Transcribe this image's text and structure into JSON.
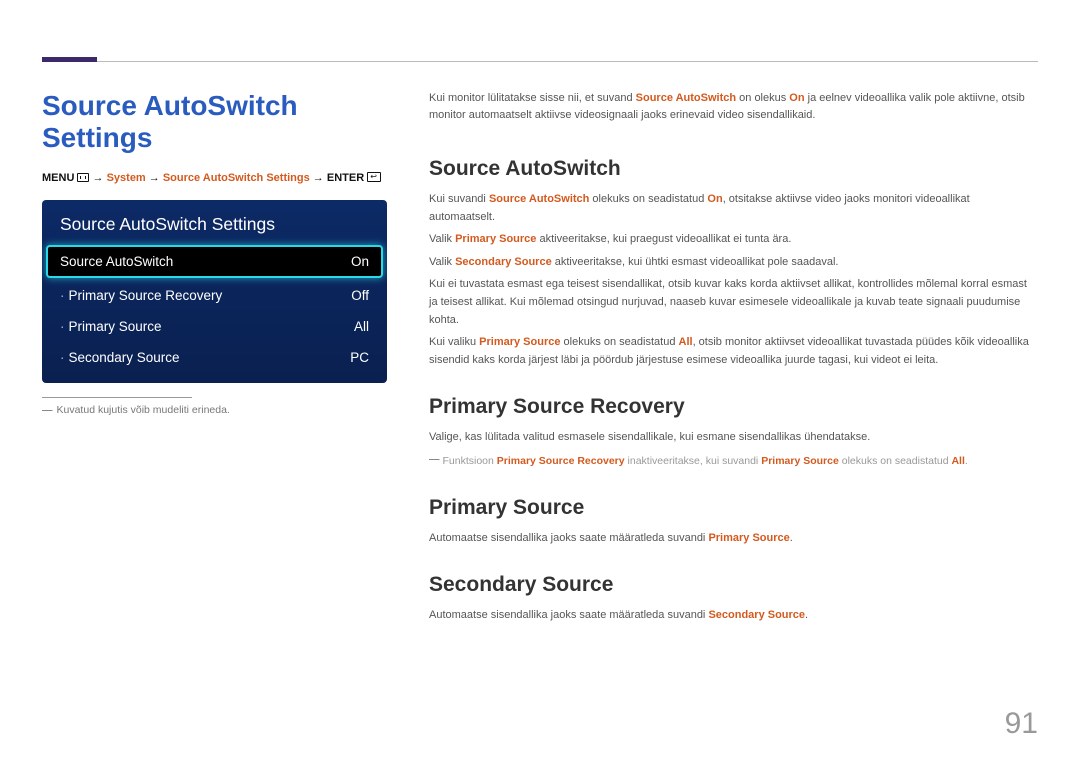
{
  "page_number": "91",
  "main_title": "Source AutoSwitch Settings",
  "menupath": {
    "menu": "MENU",
    "arrow": "→",
    "system": "System",
    "item": "Source AutoSwitch Settings",
    "enter": "ENTER"
  },
  "osd": {
    "title": "Source AutoSwitch Settings",
    "rows": [
      {
        "label": "Source AutoSwitch",
        "value": "On",
        "selected": true,
        "dot": false
      },
      {
        "label": "Primary Source Recovery",
        "value": "Off",
        "selected": false,
        "dot": true
      },
      {
        "label": "Primary Source",
        "value": "All",
        "selected": false,
        "dot": true
      },
      {
        "label": "Secondary Source",
        "value": "PC",
        "selected": false,
        "dot": true
      }
    ]
  },
  "footnote": "Kuvatud kujutis võib mudeliti erineda.",
  "intro": {
    "p1a": "Kui monitor lülitatakse sisse nii, et suvand ",
    "p1b": "Source AutoSwitch",
    "p1c": " on olekus ",
    "p1d": "On",
    "p1e": " ja eelnev videoallika valik pole aktiivne, otsib monitor automaatselt aktiivse videosignaali jaoks erinevaid video sisendallikaid."
  },
  "sections": {
    "sas": {
      "h": "Source AutoSwitch",
      "p1a": "Kui suvandi ",
      "p1b": "Source AutoSwitch",
      "p1c": " olekuks on seadistatud ",
      "p1d": "On",
      "p1e": ", otsitakse aktiivse video jaoks monitori videoallikat automaatselt.",
      "p2a": "Valik ",
      "p2b": "Primary Source",
      "p2c": " aktiveeritakse, kui praegust videoallikat ei tunta ära.",
      "p3a": "Valik ",
      "p3b": "Secondary Source",
      "p3c": " aktiveeritakse, kui ühtki esmast videoallikat pole saadaval.",
      "p4": "Kui ei tuvastata esmast ega teisest sisendallikat, otsib kuvar kaks korda aktiivset allikat, kontrollides mõlemal korral esmast ja teisest allikat. Kui mõlemad otsingud nurjuvad, naaseb kuvar esimesele videoallikale ja kuvab teate signaali puudumise kohta.",
      "p5a": "Kui valiku ",
      "p5b": "Primary Source",
      "p5c": " olekuks on seadistatud ",
      "p5d": "All",
      "p5e": ", otsib monitor aktiivset videoallikat tuvastada püüdes kõik videoallika sisendid kaks korda järjest läbi ja pöördub järjestuse esimese videoallika juurde tagasi, kui videot ei leita."
    },
    "psr": {
      "h": "Primary Source Recovery",
      "p1": "Valige, kas lülitada valitud esmasele sisendallikale, kui esmane sisendallikas ühendatakse.",
      "note_a": "Funktsioon ",
      "note_b": "Primary Source Recovery",
      "note_c": " inaktiveeritakse, kui suvandi ",
      "note_d": "Primary Source",
      "note_e": " olekuks on seadistatud ",
      "note_f": "All",
      "note_g": "."
    },
    "ps": {
      "h": "Primary Source",
      "p1a": "Automaatse sisendallika jaoks saate määratleda suvandi ",
      "p1b": "Primary Source",
      "p1c": "."
    },
    "ss": {
      "h": "Secondary Source",
      "p1a": "Automaatse sisendallika jaoks saate määratleda suvandi ",
      "p1b": "Secondary Source",
      "p1c": "."
    }
  }
}
